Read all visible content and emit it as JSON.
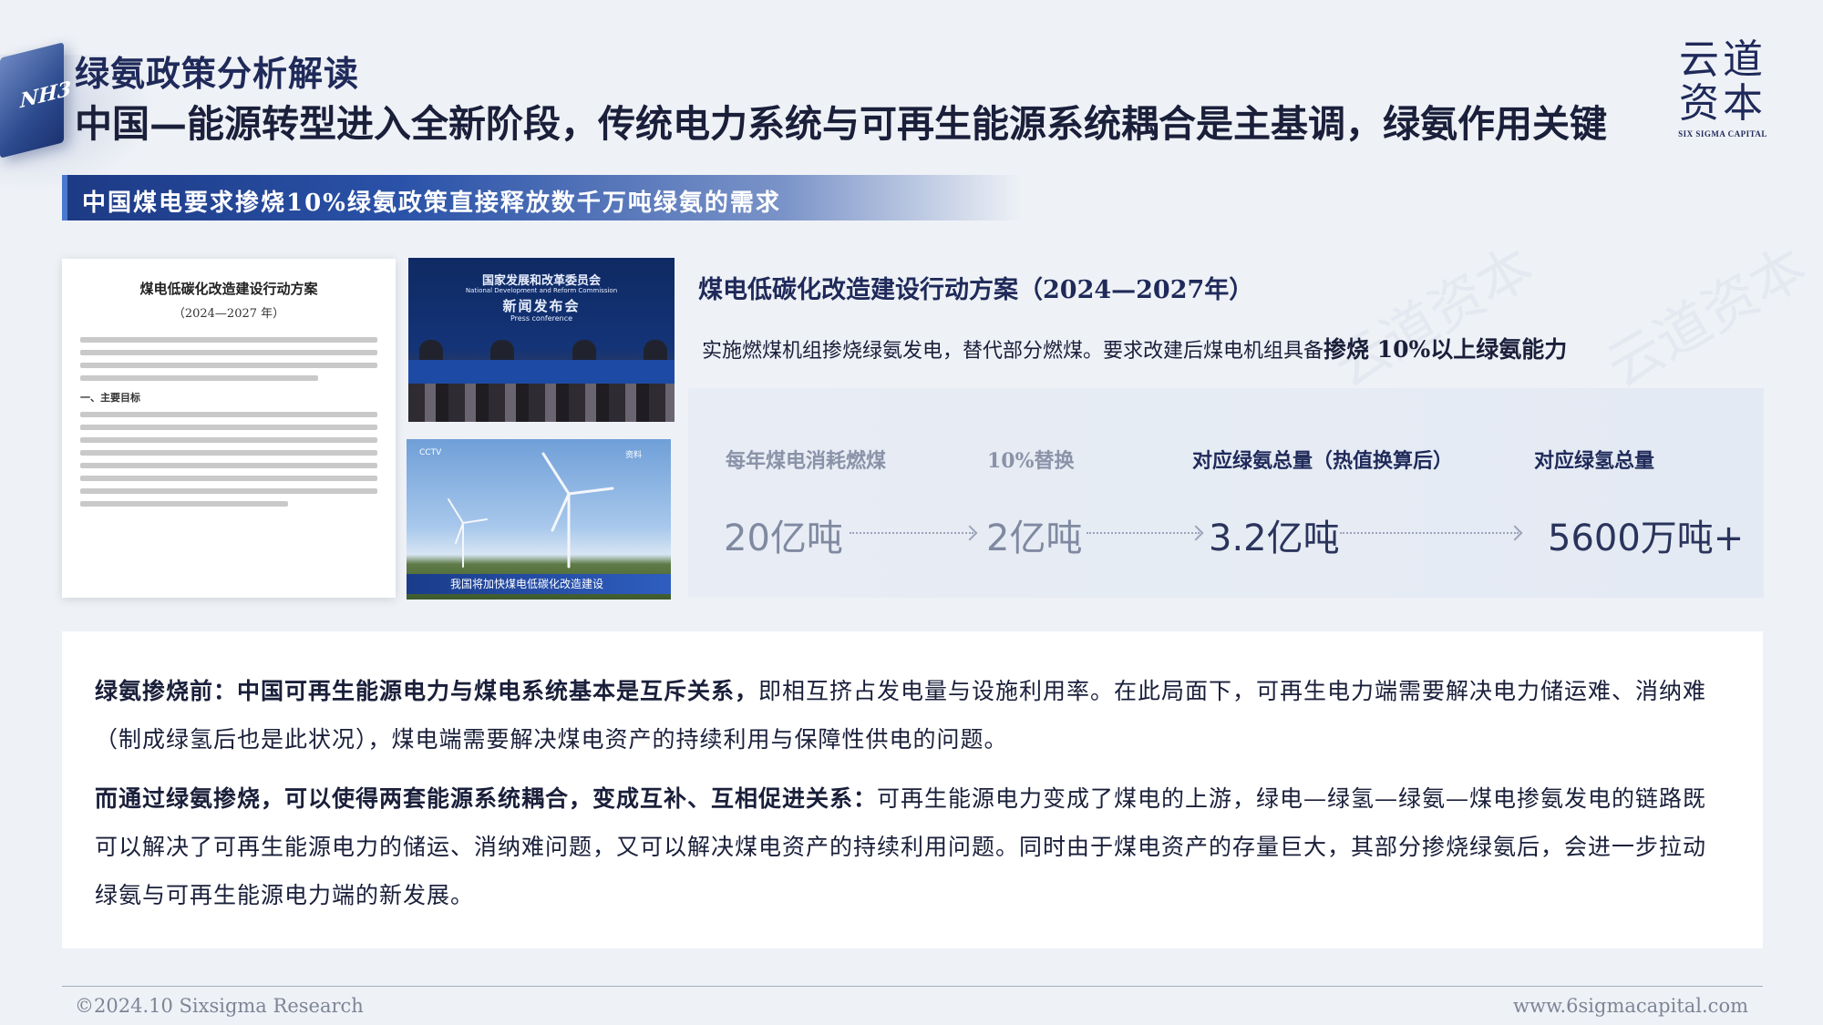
{
  "header": {
    "subtitle": "绿氨政策分析解读",
    "title": "中国—能源转型进入全新阶段，传统电力系统与可再生能源系统耦合是主基调，绿氨作用关键",
    "cube_label": "NH3"
  },
  "logo": {
    "cn_line1": "云道",
    "cn_line2": "资本",
    "en": "SIX SIGMA CAPITAL"
  },
  "banner": {
    "text": "中国煤电要求掺烧10%绿氨政策直接释放数千万吨绿氨的需求"
  },
  "doc_image": {
    "title": "煤电低碳化改造建设行动方案",
    "subtitle": "（2024—2027 年）",
    "section": "一、主要目标"
  },
  "press_image": {
    "org": "国家发展和改革委员会",
    "org_en": "National Development and Reform Commission",
    "event": "新闻发布会",
    "event_en": "Press conference"
  },
  "wind_image": {
    "caption": "我国将加快煤电低碳化改造建设",
    "tag_left": "CCTV",
    "tag_right": "资料"
  },
  "plan": {
    "title": "煤电低碳化改造建设行动方案（2024—2027年）",
    "desc_normal": "实施燃煤机组掺烧绿氨发电，替代部分燃煤。要求改建后煤电机组具备",
    "desc_bold": "掺烧 10%以上绿氨能力"
  },
  "flow": [
    {
      "label": "每年煤电消耗燃煤",
      "value": "20亿吨"
    },
    {
      "label": "10%替换",
      "value": "2亿吨"
    },
    {
      "label": "对应绿氨总量（热值换算后）",
      "value": "3.2亿吨"
    },
    {
      "label": "对应绿氢总量",
      "value": "5600万吨+"
    }
  ],
  "paragraphs": {
    "p1_bold": "绿氨掺烧前：中国可再生能源电力与煤电系统基本是互斥关系，",
    "p1_text": "即相互挤占发电量与设施利用率。在此局面下，可再生电力端需要解决电力储运难、消纳难（制成绿氢后也是此状况），煤电端需要解决煤电资产的持续利用与保障性供电的问题。",
    "p2_bold": "而通过绿氨掺烧，可以使得两套能源系统耦合，变成互补、互相促进关系：",
    "p2_text": "可再生能源电力变成了煤电的上游，绿电—绿氢—绿氨—煤电掺氨发电的链路既可以解决了可再生能源电力的储运、消纳难问题，又可以解决煤电资产的持续利用问题。同时由于煤电资产的存量巨大，其部分掺烧绿氨后，会进一步拉动绿氨与可再生能源电力端的新发展。"
  },
  "footer": {
    "left": "©2024.10 Sixsigma Research",
    "right": "www.6sigmacapital.com"
  },
  "colors": {
    "navy": "#1f2a5a",
    "banner_blue": "#1d3a85",
    "background": "#eef1f6"
  }
}
